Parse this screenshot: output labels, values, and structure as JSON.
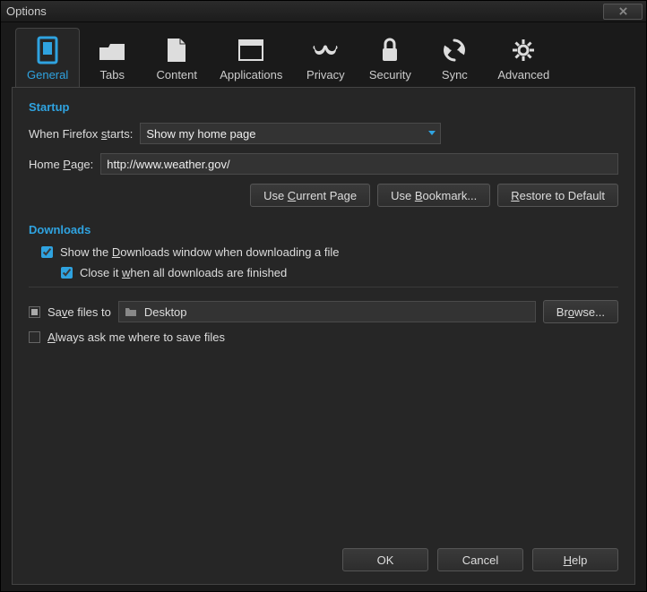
{
  "window": {
    "title": "Options"
  },
  "tabs": {
    "general": "General",
    "tabs": "Tabs",
    "content": "Content",
    "applications": "Applications",
    "privacy": "Privacy",
    "security": "Security",
    "sync": "Sync",
    "advanced": "Advanced"
  },
  "startup": {
    "header": "Startup",
    "when_starts_label": "When Firefox starts:",
    "when_starts_value": "Show my home page",
    "home_page_label": "Home Page:",
    "home_page_value": "http://www.weather.gov/",
    "use_current": "Use Current Page",
    "use_bookmark": "Use Bookmark...",
    "restore_default": "Restore to Default"
  },
  "downloads": {
    "header": "Downloads",
    "show_window": "Show the Downloads window when downloading a file",
    "close_when_done": "Close it when all downloads are finished",
    "save_files_to": "Save files to",
    "save_path": "Desktop",
    "browse": "Browse...",
    "always_ask": "Always ask me where to save files"
  },
  "footer": {
    "ok": "OK",
    "cancel": "Cancel",
    "help": "Help"
  }
}
